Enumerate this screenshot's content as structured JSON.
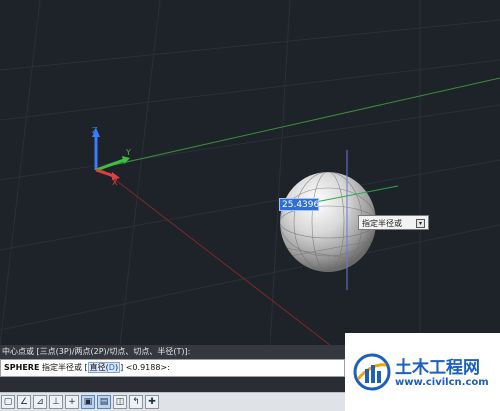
{
  "viewport": {
    "background": "#1e2229",
    "ucs_labels": {
      "x": "X",
      "y": "Y",
      "z": "Z"
    },
    "dynamic_input": {
      "value": "25.4396"
    },
    "tooltip": {
      "text": "指定半径或",
      "dropdown_icon": "down-arrow"
    }
  },
  "command": {
    "history_line": "中心点或 [三点(3P)/两点(2P)/切点、切点、半径(T)]:",
    "current": {
      "command": "SPHERE",
      "prompt": "指定半径或 [",
      "option_label": "直径(",
      "option_key": "D",
      "option_close": ")",
      "suffix": "] <0.9188>:"
    }
  },
  "statusbar": {
    "buttons": [
      {
        "icon": "infer-constraints-icon",
        "glyph": "▢"
      },
      {
        "icon": "snap-mode-icon",
        "glyph": "∠"
      },
      {
        "icon": "grid-display-icon",
        "glyph": "⊿"
      },
      {
        "icon": "ortho-mode-icon",
        "glyph": "⊥"
      },
      {
        "icon": "polar-tracking-icon",
        "glyph": "+"
      },
      {
        "icon": "object-snap-icon",
        "glyph": "▣"
      },
      {
        "icon": "3d-object-snap-icon",
        "glyph": "▤"
      },
      {
        "icon": "object-snap-tracking-icon",
        "glyph": "◫"
      },
      {
        "icon": "dynamic-ucs-icon",
        "glyph": "↰"
      },
      {
        "icon": "dynamic-input-icon",
        "glyph": "✚"
      }
    ]
  },
  "watermark": {
    "brand_cn": "土木工程网",
    "url": "www.civilcn.com",
    "brand_color": "#1b5fbf"
  }
}
